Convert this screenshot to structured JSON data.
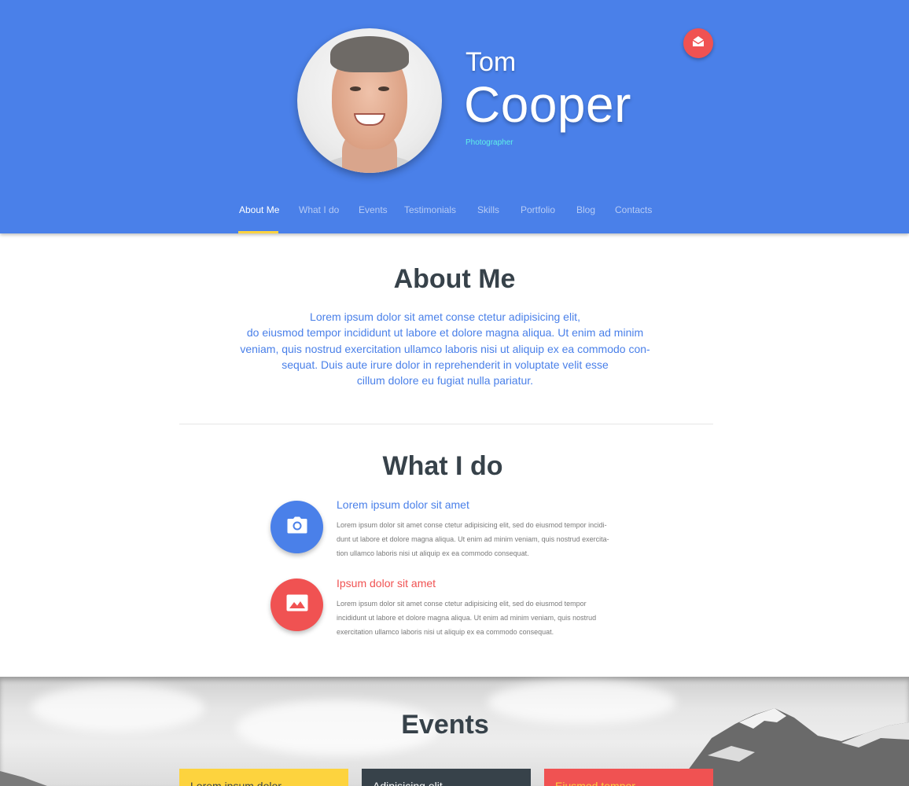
{
  "profile": {
    "first_name": "Tom",
    "last_name": "Cooper",
    "role": "Photographer"
  },
  "header": {
    "mail_icon": "envelope-open-icon",
    "colors": {
      "header_bg": "#4a80e9",
      "accent_yellow": "#fdd33e",
      "accent_red": "#f05252"
    }
  },
  "nav": {
    "items": [
      {
        "label": "About Me",
        "active": true
      },
      {
        "label": "What I do",
        "active": false
      },
      {
        "label": "Events",
        "active": false
      },
      {
        "label": "Testimonials",
        "active": false
      },
      {
        "label": "Skills",
        "active": false
      },
      {
        "label": "Portfolio",
        "active": false
      },
      {
        "label": "Blog",
        "active": false
      },
      {
        "label": "Contacts",
        "active": false
      }
    ]
  },
  "about": {
    "title": "About Me",
    "lines": [
      "Lorem ipsum dolor sit amet conse ctetur adipisicing elit,",
      "do eiusmod tempor incididunt ut labore et dolore magna aliqua. Ut enim ad minim",
      "veniam, quis nostrud exercitation ullamco laboris nisi ut aliquip ex ea commodo con-",
      "sequat. Duis aute irure dolor in reprehenderit in voluptate velit esse",
      "cillum dolore eu fugiat nulla pariatur."
    ]
  },
  "what_i_do": {
    "title": "What I do",
    "services": [
      {
        "icon": "camera-icon",
        "title": "Lorem ipsum dolor sit amet",
        "lines": [
          "Lorem ipsum dolor sit amet conse ctetur adipisicing elit, sed do eiusmod tempor incidi-",
          "dunt ut labore et dolore magna aliqua. Ut enim ad minim veniam, quis nostrud exercita-",
          "tion ullamco laboris nisi ut aliquip ex ea commodo consequat."
        ]
      },
      {
        "icon": "image-icon",
        "title": "Ipsum dolor sit amet",
        "lines": [
          "Lorem ipsum dolor sit amet conse ctetur adipisicing elit, sed do eiusmod tempor",
          "incididunt ut labore et dolore magna aliqua. Ut enim ad minim veniam, quis nostrud",
          "exercitation ullamco laboris nisi ut aliquip ex ea commodo consequat."
        ]
      }
    ]
  },
  "events": {
    "title": "Events",
    "cards": [
      {
        "label": "Lorem ipsum dolor"
      },
      {
        "label": "Adipisicing elit"
      },
      {
        "label": "Eiusmod tempor"
      }
    ]
  }
}
